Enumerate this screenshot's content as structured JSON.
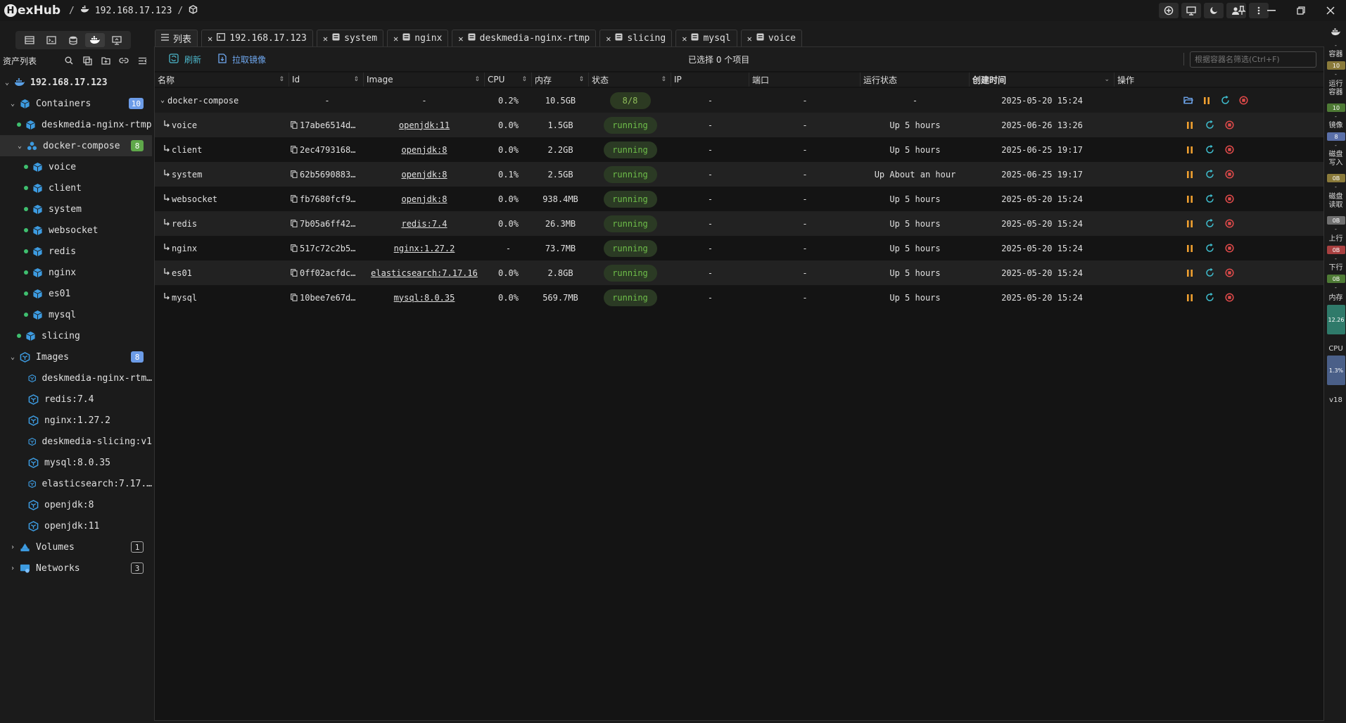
{
  "app": {
    "name": "exHub",
    "logo_letter": "H"
  },
  "breadcrumb": {
    "sep1": "/",
    "host": "192.168.17.123",
    "sep2": "/"
  },
  "sidebar": {
    "header": "资产列表",
    "root": "192.168.17.123",
    "containers": {
      "label": "Containers",
      "count": "10"
    },
    "items": {
      "nginx_rtmp": "deskmedia-nginx-rtmp",
      "compose": {
        "label": "docker-compose",
        "count": "8"
      },
      "voice": "voice",
      "client": "client",
      "system": "system",
      "websocket": "websocket",
      "redis": "redis",
      "nginx": "nginx",
      "es01": "es01",
      "mysql": "mysql",
      "slicing": "slicing"
    },
    "images": {
      "label": "Images",
      "count": "8",
      "list": [
        "deskmedia-nginx-rtm…",
        "redis:7.4",
        "nginx:1.27.2",
        "deskmedia-slicing:v1",
        "mysql:8.0.35",
        "elasticsearch:7.17.…",
        "openjdk:8",
        "openjdk:11"
      ]
    },
    "volumes": {
      "label": "Volumes",
      "count": "1"
    },
    "networks": {
      "label": "Networks",
      "count": "3"
    }
  },
  "tabs": [
    "列表",
    "192.168.17.123",
    "system",
    "nginx",
    "deskmedia-nginx-rtmp",
    "slicing",
    "mysql",
    "voice"
  ],
  "toolbar": {
    "refresh": "刷新",
    "pull": "拉取镜像",
    "selected": "已选择 0 个项目",
    "filter_placeholder": "根据容器名筛选(Ctrl+F)"
  },
  "columns": [
    "名称",
    "Id",
    "Image",
    "CPU",
    "内存",
    "状态",
    "IP",
    "端口",
    "运行状态",
    "创建时间",
    "操作"
  ],
  "group_row": {
    "name": "docker-compose",
    "id": "-",
    "image": "-",
    "cpu": "0.2%",
    "mem": "10.5GB",
    "state": "8/8",
    "ip": "-",
    "port": "-",
    "run": "-",
    "created": "2025-05-20 15:24"
  },
  "rows": [
    {
      "name": "voice",
      "id": "17abe6514d…",
      "image": "openjdk:11",
      "cpu": "0.0%",
      "mem": "1.5GB",
      "state": "running",
      "ip": "-",
      "port": "-",
      "run": "Up 5 hours",
      "created": "2025-06-26 13:26"
    },
    {
      "name": "client",
      "id": "2ec4793168…",
      "image": "openjdk:8",
      "cpu": "0.0%",
      "mem": "2.2GB",
      "state": "running",
      "ip": "-",
      "port": "-",
      "run": "Up 5 hours",
      "created": "2025-06-25 19:17"
    },
    {
      "name": "system",
      "id": "62b5690883…",
      "image": "openjdk:8",
      "cpu": "0.1%",
      "mem": "2.5GB",
      "state": "running",
      "ip": "-",
      "port": "-",
      "run": "Up About an hour",
      "created": "2025-06-25 19:17"
    },
    {
      "name": "websocket",
      "id": "fb7680fcf9…",
      "image": "openjdk:8",
      "cpu": "0.0%",
      "mem": "938.4MB",
      "state": "running",
      "ip": "-",
      "port": "-",
      "run": "Up 5 hours",
      "created": "2025-05-20 15:24"
    },
    {
      "name": "redis",
      "id": "7b05a6ff42…",
      "image": "redis:7.4",
      "cpu": "0.0%",
      "mem": "26.3MB",
      "state": "running",
      "ip": "-",
      "port": "-",
      "run": "Up 5 hours",
      "created": "2025-05-20 15:24"
    },
    {
      "name": "nginx",
      "id": "517c72c2b5…",
      "image": "nginx:1.27.2",
      "cpu": "-",
      "mem": "73.7MB",
      "state": "running",
      "ip": "-",
      "port": "-",
      "run": "Up 5 hours",
      "created": "2025-05-20 15:24"
    },
    {
      "name": "es01",
      "id": "0ff02acfdc…",
      "image": "elasticsearch:7.17.16",
      "cpu": "0.0%",
      "mem": "2.8GB",
      "state": "running",
      "ip": "-",
      "port": "-",
      "run": "Up 5 hours",
      "created": "2025-05-20 15:24"
    },
    {
      "name": "mysql",
      "id": "10bee7e67d…",
      "image": "mysql:8.0.35",
      "cpu": "0.0%",
      "mem": "569.7MB",
      "state": "running",
      "ip": "-",
      "port": "-",
      "run": "Up 5 hours",
      "created": "2025-05-20 15:24"
    }
  ],
  "stats": {
    "containers": {
      "label": "容器",
      "value": "10"
    },
    "running": {
      "label": "运行容器",
      "value": "10"
    },
    "images": {
      "label": "镜像",
      "value": "8"
    },
    "disk_write": {
      "label": "磁盘写入",
      "value": "0B"
    },
    "disk_read": {
      "label": "磁盘读取",
      "value": "0B"
    },
    "up": {
      "label": "上行",
      "value": "0B"
    },
    "down": {
      "label": "下行",
      "value": "0B"
    },
    "memory": {
      "label": "内存",
      "value": "12.26"
    },
    "cpu": {
      "label": "CPU",
      "value": "1.3%"
    },
    "version": "v18",
    "dash": "-"
  },
  "colors": {
    "accent_blue": "#6c9ce8",
    "running_green": "#6fbf4a",
    "pause_orange": "#f0a030",
    "restart_teal": "#3fbfd0",
    "stop_red": "#e04a4a"
  }
}
